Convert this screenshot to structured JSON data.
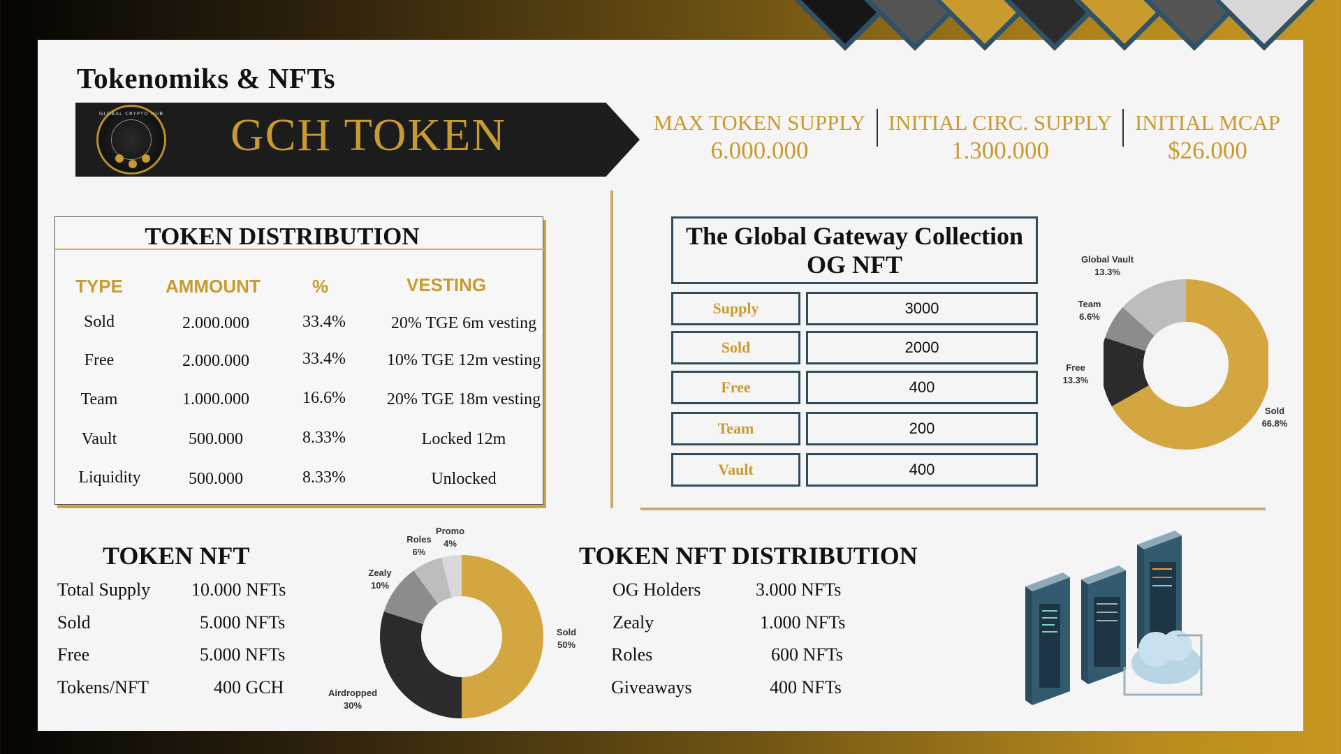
{
  "colors": {
    "gold": "#c99a2e",
    "dark": "#1c1c1c",
    "teal_border": "#2f4d5c",
    "chart_gold": "#d4a640",
    "chart_black": "#2b2b2b",
    "chart_gray": "#8c8c8c",
    "chart_light": "#bdbdbd",
    "chart_lighter": "#d9d9d9"
  },
  "header": {
    "title": "Tokenomiks & NFTs",
    "banner_title": "GCH TOKEN",
    "logo_text": "GLOBAL CRYPTO HUB"
  },
  "stats": [
    {
      "label": "MAX TOKEN SUPPLY",
      "value": "6.000.000"
    },
    {
      "label": "INITIAL CIRC. SUPPLY",
      "value": "1.300.000"
    },
    {
      "label": "INITIAL MCAP",
      "value": "$26.000"
    }
  ],
  "token_distribution": {
    "title": "TOKEN DISTRIBUTION",
    "headers": [
      "TYPE",
      "AMMOUNT",
      "%",
      "VESTING"
    ],
    "rows": [
      {
        "type": "Sold",
        "amount": "2.000.000",
        "pct": "33.4%",
        "vesting": "20% TGE 6m vesting"
      },
      {
        "type": "Free",
        "amount": "2.000.000",
        "pct": "33.4%",
        "vesting": "10% TGE 12m vesting"
      },
      {
        "type": "Team",
        "amount": "1.000.000",
        "pct": "16.6%",
        "vesting": "20% TGE 18m vesting"
      },
      {
        "type": "Vault",
        "amount": "500.000",
        "pct": "8.33%",
        "vesting": "Locked 12m"
      },
      {
        "type": "Liquidity",
        "amount": "500.000",
        "pct": "8.33%",
        "vesting": "Unlocked"
      }
    ]
  },
  "og_nft": {
    "title_line1": "The Global Gateway Collection",
    "title_line2": "OG NFT",
    "rows": [
      {
        "key": "Supply",
        "value": "3000"
      },
      {
        "key": "Sold",
        "value": "2000"
      },
      {
        "key": "Free",
        "value": "400"
      },
      {
        "key": "Team",
        "value": "200"
      },
      {
        "key": "Vault",
        "value": "400"
      }
    ]
  },
  "token_nft": {
    "title": "TOKEN NFT",
    "rows": [
      {
        "label": "Total Supply",
        "value": "10.000 NFTs"
      },
      {
        "label": "Sold",
        "value": "5.000 NFTs"
      },
      {
        "label": "Free",
        "value": "5.000 NFTs"
      },
      {
        "label": "Tokens/NFT",
        "value": "400 GCH"
      }
    ]
  },
  "token_nft_distribution": {
    "title": "TOKEN NFT DISTRIBUTION",
    "rows": [
      {
        "label": "OG Holders",
        "value": "3.000 NFTs"
      },
      {
        "label": "Zealy",
        "value": "1.000 NFTs"
      },
      {
        "label": "Roles",
        "value": "600 NFTs"
      },
      {
        "label": "Giveaways",
        "value": "400 NFTs"
      }
    ]
  },
  "chart_data": [
    {
      "type": "pie",
      "donut": true,
      "categories": [
        "Sold",
        "Free",
        "Team",
        "Global Vault"
      ],
      "values": [
        66.8,
        13.3,
        6.6,
        13.3
      ],
      "labels": [
        "66.8%",
        "13.3%",
        "6.6%",
        "13.3%"
      ],
      "colors": [
        "#d4a640",
        "#2b2b2b",
        "#8c8c8c",
        "#bdbdbd"
      ]
    },
    {
      "type": "pie",
      "donut": true,
      "categories": [
        "Sold",
        "Airdropped",
        "Zealy",
        "Roles",
        "Promo"
      ],
      "values": [
        50,
        30,
        10,
        6,
        4
      ],
      "labels": [
        "50%",
        "30%",
        "10%",
        "6%",
        "4%"
      ],
      "colors": [
        "#d4a640",
        "#2b2b2b",
        "#8c8c8c",
        "#bdbdbd",
        "#d9d9d9"
      ]
    }
  ]
}
